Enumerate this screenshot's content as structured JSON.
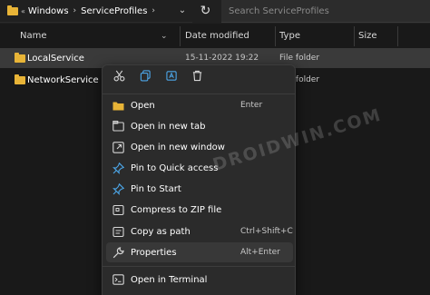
{
  "address_bar": {
    "overflow": "«",
    "crumbs": [
      "Windows",
      "ServiceProfiles"
    ]
  },
  "search": {
    "placeholder": "Search ServiceProfiles"
  },
  "columns": {
    "name": "Name",
    "date": "Date modified",
    "type": "Type",
    "size": "Size"
  },
  "files": [
    {
      "name": "LocalService",
      "date": "15-11-2022 19:22",
      "type": "File folder"
    },
    {
      "name": "NetworkService",
      "date": "",
      "type": "File folder"
    }
  ],
  "context_menu": {
    "quick_actions": [
      "cut-icon",
      "copy-icon",
      "rename-icon",
      "delete-icon"
    ],
    "items": [
      {
        "label": "Open",
        "shortcut": "Enter",
        "icon": "folder-icon"
      },
      {
        "label": "Open in new tab",
        "shortcut": "",
        "icon": "new-tab-icon"
      },
      {
        "label": "Open in new window",
        "shortcut": "",
        "icon": "new-window-icon"
      },
      {
        "label": "Pin to Quick access",
        "shortcut": "",
        "icon": "pin-icon"
      },
      {
        "label": "Pin to Start",
        "shortcut": "",
        "icon": "pin-start-icon"
      },
      {
        "label": "Compress to ZIP file",
        "shortcut": "",
        "icon": "zip-icon"
      },
      {
        "label": "Copy as path",
        "shortcut": "Ctrl+Shift+C",
        "icon": "copy-path-icon"
      },
      {
        "label": "Properties",
        "shortcut": "Alt+Enter",
        "icon": "wrench-icon"
      },
      {
        "label": "Open in Terminal",
        "shortcut": "",
        "icon": "terminal-icon"
      }
    ]
  },
  "watermark": "DROIDWIN.COM",
  "colors": {
    "background": "#191919",
    "menu_bg": "#2b2b2b",
    "folder": "#e8b437",
    "accent_blue": "#4ca6e8"
  }
}
